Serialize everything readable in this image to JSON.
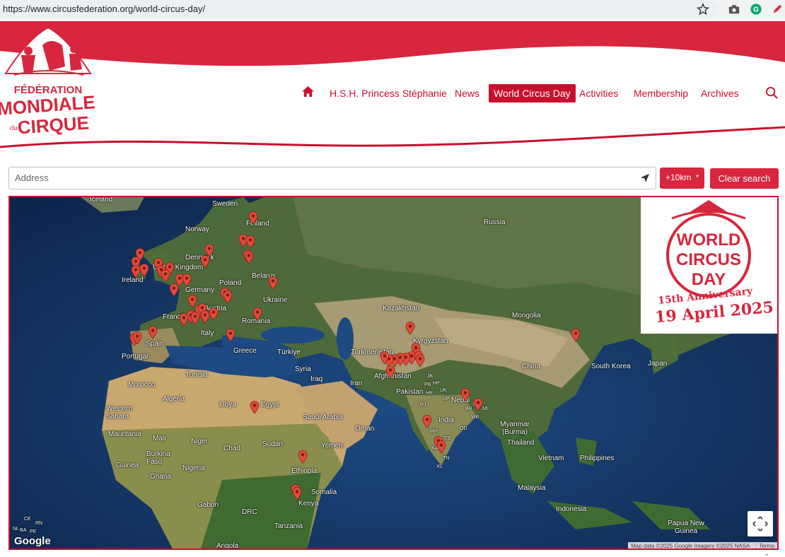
{
  "browser": {
    "url": "https://www.circusfederation.org/world-circus-day/",
    "icons": [
      "star-icon",
      "camera-icon",
      "grammarly-icon",
      "pen-icon"
    ]
  },
  "logo": {
    "line1": "FÉDÉRATION",
    "line2": "MONDIALE",
    "line3": "du",
    "line4": "CIRQUE"
  },
  "nav": {
    "home_icon": "home-icon",
    "items": [
      {
        "label": "H.S.H. Princess Stéphanie"
      },
      {
        "label": "News"
      },
      {
        "label": "World Circus Day",
        "active": true
      },
      {
        "label": "Activities"
      },
      {
        "label": "Membership"
      },
      {
        "label": "Archives"
      }
    ],
    "search_icon": "search-icon"
  },
  "search": {
    "placeholder": "Address",
    "radius_label": "+10km",
    "clear_label": "Clear search"
  },
  "badge": {
    "title_line1": "WORLD",
    "title_line2": "CIRCUS",
    "title_line3": "DAY",
    "anniversary": "15th Anniversary",
    "date": "19 April 2025"
  },
  "map": {
    "labels": {
      "iceland": "Iceland",
      "sweden": "Sweden",
      "finland": "Finland",
      "norway": "Norway",
      "russia": "Russia",
      "denmark": "Denmark",
      "united_kingdom": "United Kingdom",
      "belarus": "Belarus",
      "poland": "Poland",
      "ireland": "Ireland",
      "germany": "Germany",
      "ukraine": "Ukraine",
      "france": "France",
      "austria": "Austria",
      "romania": "Romania",
      "italy": "Italy",
      "spain": "Spain",
      "portugal": "Portugal",
      "greece": "Greece",
      "turkiye": "Türkiye",
      "kazakhstan": "Kazakhstan",
      "mongolia": "Mongolia",
      "kyrgyzstan": "Kyrgyzstan",
      "turkmenistan": "Turkmenistan",
      "china": "China",
      "south_korea": "South Korea",
      "japan": "Japan",
      "tunisia": "Tunisia",
      "syria": "Syria",
      "iraq": "Iraq",
      "iran": "Iran",
      "afghanistan": "Afghanistan",
      "morocco": "Morocco",
      "pakistan": "Pakistan",
      "algeria": "Algeria",
      "libya": "Libya",
      "egypt": "Egypt",
      "nepal": "Nepal",
      "western_sahara": "Western Sahara",
      "saudi_arabia": "Saudi Arabia",
      "oman": "Oman",
      "india": "India",
      "myanmar": "Myanmar (Burma)",
      "mauritania": "Mauritania",
      "mali": "Mali",
      "niger": "Niger",
      "chad": "Chad",
      "sudan": "Sudan",
      "yemen": "Yemen",
      "thailand": "Thailand",
      "burkina_faso": "Burkina Faso",
      "vietnam": "Vietnam",
      "philippines": "Philippines",
      "guinea": "Guinea",
      "nigeria": "Nigeria",
      "ethiopia": "Ethiopia",
      "ghana": "Ghana",
      "somalia": "Somalia",
      "malaysia": "Malaysia",
      "gabon": "Gabon",
      "kenya": "Kenya",
      "drc": "DRC",
      "indonesia": "Indonesia",
      "tanzania": "Tanzania",
      "papua_new_guinea": "Papua New Guinea",
      "angola": "Angola",
      "jk": "JK",
      "hp": "HP",
      "pb": "PB",
      "uk": "UK",
      "hr": "HR",
      "rj": "RJ",
      "up": "UP",
      "sk": "SK",
      "br": "BR",
      "ml": "ML",
      "wb": "WB",
      "mh": "MH",
      "od": "OD",
      "ts": "TS",
      "ka": "KA",
      "tn": "TN",
      "kl": "KL",
      "ce": "CE",
      "rn": "RN",
      "pe": "PE",
      "ba": "BA",
      "nl": "NL"
    },
    "google_label": "Google",
    "attribution": "Map data ©2025 Google Imagery ©2025 NASA",
    "terms": "Terms",
    "fullscreen_icon": "fullscreen-icon",
    "marker_icon": "map-marker-icon"
  },
  "colors": {
    "brand_red": "#c8102e",
    "button_red": "#d7263d",
    "marker_red": "#e04b3a"
  }
}
